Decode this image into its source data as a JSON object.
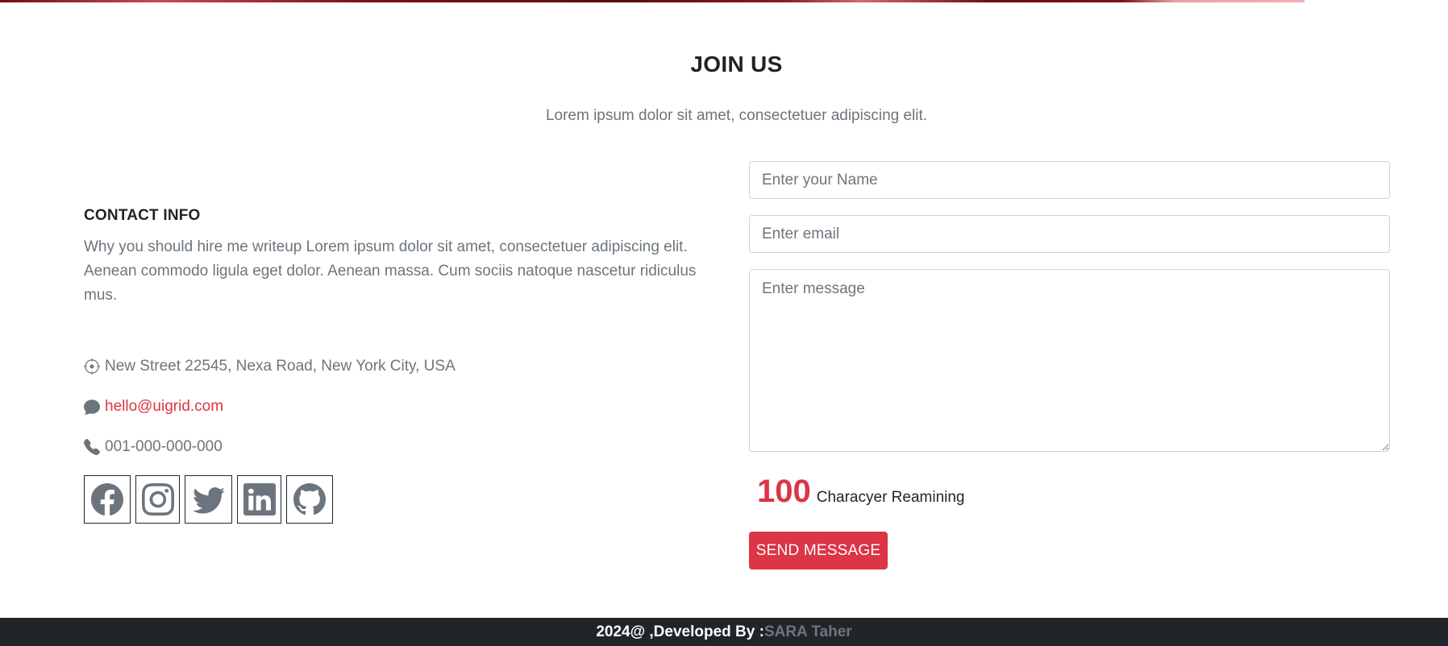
{
  "section": {
    "title": "JOIN US",
    "subtitle": "Lorem ipsum dolor sit amet, consectetuer adipiscing elit."
  },
  "contact": {
    "heading": "CONTACT INFO",
    "description": "Why you should hire me writeup Lorem ipsum dolor sit amet, consectetuer adipiscing elit. Aenean commodo ligula eget dolor. Aenean massa. Cum sociis natoque nascetur ridiculus mus.",
    "address": "New Street 22545, Nexa Road, New York City, USA",
    "email": "hello@uigrid.com",
    "phone": "001-000-000-000",
    "address_icon": "location-crosshair-icon",
    "email_icon": "chat-bubble-icon",
    "phone_icon": "phone-icon"
  },
  "socials": [
    {
      "name": "facebook",
      "icon": "facebook-icon"
    },
    {
      "name": "instagram",
      "icon": "instagram-icon"
    },
    {
      "name": "twitter",
      "icon": "twitter-icon"
    },
    {
      "name": "linkedin",
      "icon": "linkedin-icon"
    },
    {
      "name": "github",
      "icon": "github-icon"
    }
  ],
  "form": {
    "name_placeholder": "Enter your Name",
    "email_placeholder": "Enter email",
    "message_placeholder": "Enter message",
    "name_value": "",
    "email_value": "",
    "message_value": "",
    "counter_value": "100",
    "counter_label": "Characyer Reamining",
    "send_label": "SEND MESSAGE"
  },
  "footer": {
    "prefix": "2024@ ,Developed By :",
    "author": "SARA Taher"
  },
  "colors": {
    "accent": "#dc3545",
    "muted_text": "#6c757d",
    "dark": "#212529"
  }
}
